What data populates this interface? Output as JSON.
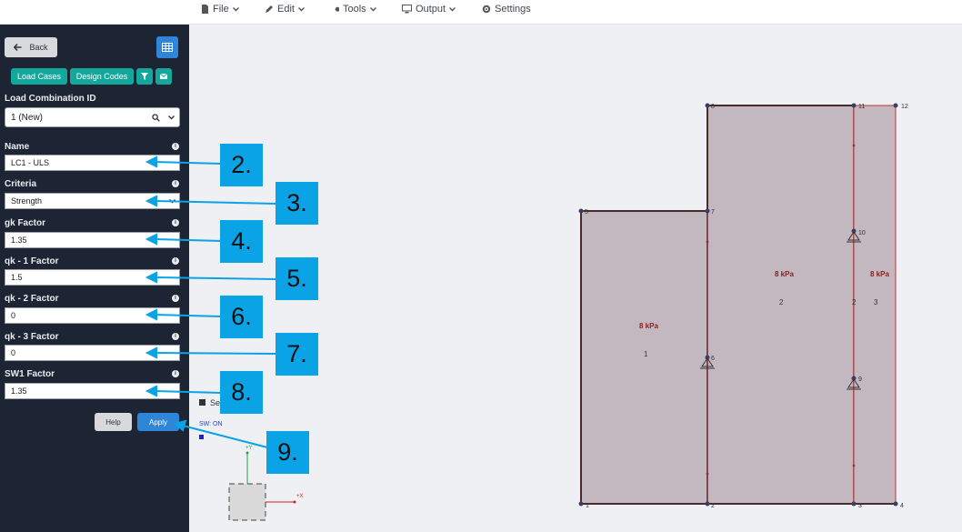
{
  "menu": {
    "file": "File",
    "edit": "Edit",
    "tools": "Tools",
    "output": "Output",
    "settings": "Settings"
  },
  "sidebar": {
    "back_label": "Back",
    "tab_load_cases": "Load Cases",
    "tab_design_codes": "Design Codes",
    "load_combination_id_label": "Load Combination ID",
    "load_combination_id_value": "1 (New)",
    "fields": {
      "name": {
        "label": "Name",
        "value": "LC1 - ULS"
      },
      "criteria": {
        "label": "Criteria",
        "value": "Strength"
      },
      "gk": {
        "label": "gk Factor",
        "value": "1.35"
      },
      "qk1": {
        "label": "qk - 1 Factor",
        "value": "1.5"
      },
      "qk2": {
        "label": "qk - 2 Factor",
        "value": "0"
      },
      "qk3": {
        "label": "qk - 3 Factor",
        "value": "0"
      },
      "sw1": {
        "label": "SW1 Factor",
        "value": "1.35"
      }
    },
    "help_label": "Help",
    "apply_label": "Apply"
  },
  "callouts": [
    "2.",
    "3.",
    "4.",
    "5.",
    "6.",
    "7.",
    "8.",
    "9."
  ],
  "canvas": {
    "legend_text": "Sec",
    "sw_status": "SW: ON",
    "axis_y": "+Y",
    "axis_x": "+X",
    "nodes": [
      "1",
      "2",
      "3",
      "4",
      "5",
      "6",
      "7",
      "8",
      "9",
      "10",
      "11",
      "12"
    ],
    "loads": [
      "8 kPa",
      "8 kPa",
      "8 kPa"
    ],
    "regions": [
      "1",
      "2",
      "2",
      "3"
    ]
  },
  "colors": {
    "sidebar_bg": "#1d2433",
    "accent_blue": "#2f86d9",
    "teal": "#14a89c",
    "callout": "#0aa3e6",
    "plate_fill": "#c4b8c0",
    "edge": "#8b2020"
  }
}
